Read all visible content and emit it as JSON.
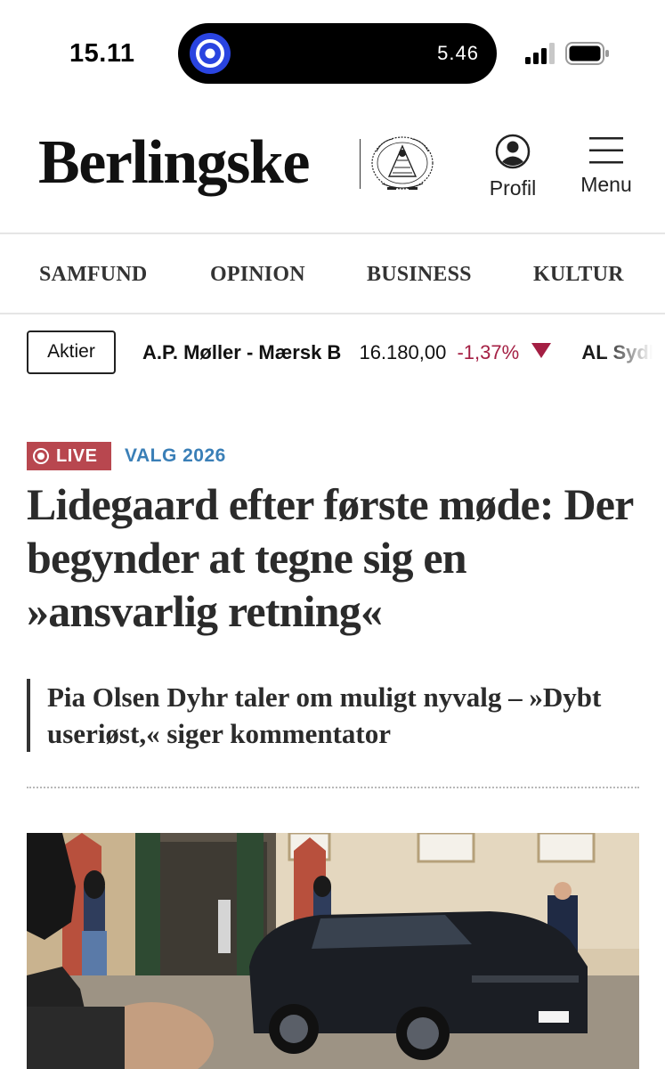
{
  "status_bar": {
    "time": "15.11",
    "island_timer": "5.46"
  },
  "header": {
    "logo": "Berlingske",
    "profile_label": "Profil",
    "menu_label": "Menu"
  },
  "nav": {
    "items": [
      {
        "label": "SAMFUND"
      },
      {
        "label": "OPINION"
      },
      {
        "label": "BUSINESS"
      },
      {
        "label": "KULTUR"
      }
    ]
  },
  "ticker": {
    "button_label": "Aktier",
    "stocks": [
      {
        "name": "A.P. Møller - Mærsk B",
        "price": "16.180,00",
        "change": "-1,37%",
        "direction": "down"
      },
      {
        "name": "AL Sydbank"
      }
    ]
  },
  "article": {
    "live_label": "LIVE",
    "topic": "VALG 2026",
    "headline": "Lidegaard efter første møde: Der begynder at tegne sig en »ansvarlig retning«",
    "related": "Pia Olsen Dyhr taler om muligt nyvalg – »Dybt useriøst,« siger kommentator"
  },
  "colors": {
    "live_badge": "#b8474f",
    "topic_tag": "#3a7fb7",
    "stock_down": "#a41f43"
  }
}
